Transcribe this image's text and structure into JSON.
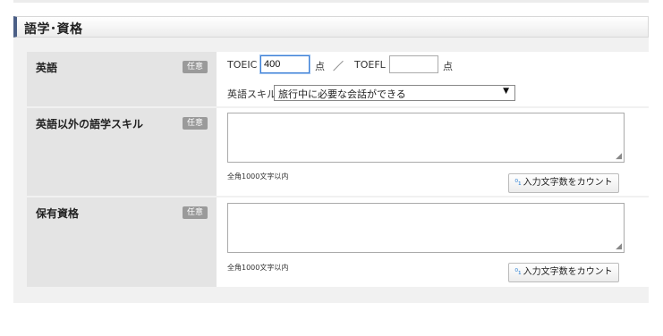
{
  "section": {
    "title": "語学･資格"
  },
  "rows": {
    "english": {
      "label": "英語",
      "badge": "任意",
      "toeic_label": "TOEIC",
      "toeic_value": "400",
      "unit": "点",
      "slash": "／",
      "toefl_label": "TOEFL",
      "toefl_value": "",
      "skill_label": "英語スキル",
      "skill_selected": "旅行中に必要な会話ができる",
      "arrow": "▼"
    },
    "other_lang": {
      "label": "英語以外の語学スキル",
      "badge": "任意",
      "textarea_value": "",
      "note": "全角1000文字以内",
      "count_button": "入力文字数をカウント",
      "count_icon": "⁰₁"
    },
    "qualifications": {
      "label": "保有資格",
      "badge": "任意",
      "textarea_value": "",
      "note": "全角1000文字以内",
      "count_button": "入力文字数をカウント",
      "count_icon": "⁰₁"
    }
  },
  "colors": {
    "accent": "#4b5f86",
    "label_bg": "#e4e4e4",
    "badge_bg": "#9a9a9a"
  }
}
